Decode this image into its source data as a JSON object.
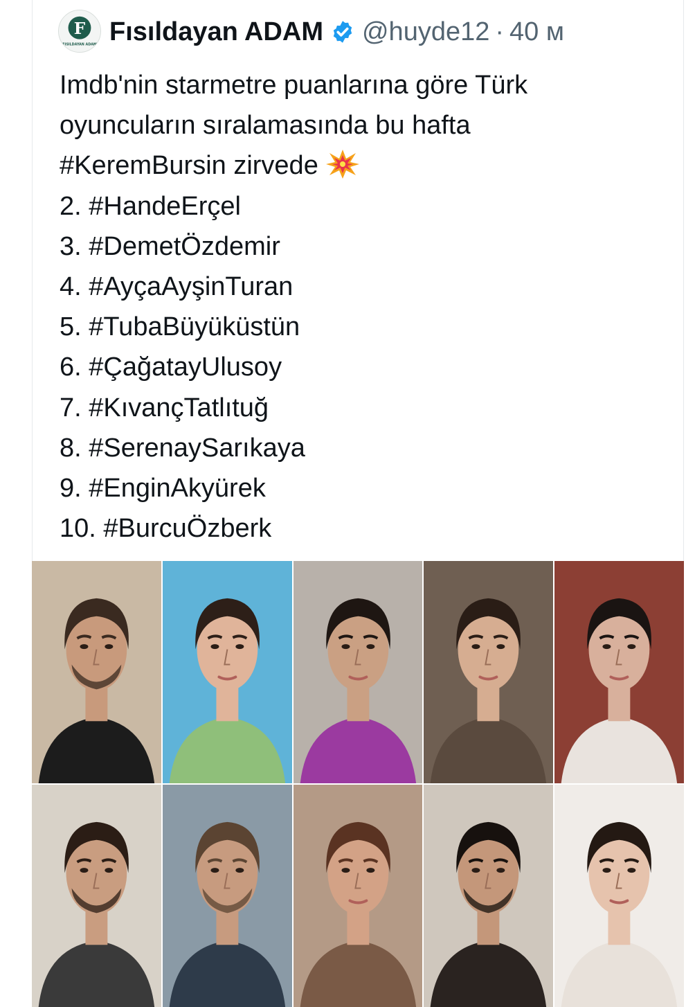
{
  "tweet": {
    "author_name": "Fısıldayan ADAM",
    "handle": "@huyde12",
    "separator": "·",
    "time": "40 м",
    "avatar_letter": "F",
    "avatar_caption": "FISILDAYAN ADAM",
    "text_lines": [
      "Imdb'nin starmetre puanlarına göre Türk",
      "oyuncuların sıralamasında bu hafta",
      "#KeremBursin zirvede",
      "2. #HandeErçel",
      "3. #DemetÖzdemir",
      "4. #AyçaAyşinTuran",
      "5. #TubaBüyüküstün",
      "6. #ÇağatayUlusoy",
      "7. #KıvançTatlıtuğ",
      "8. #SerenaySarıkaya",
      "9. #EnginAkyürek",
      "10. #BurcuÖzberk"
    ],
    "emoji": "collision-emoji"
  },
  "photos": [
    {
      "id": "photo-1",
      "bg": "#c9b9a4",
      "skin": "#c89a7c",
      "hair": "#3a2a20",
      "cloth": "#1c1c1c",
      "beard": true
    },
    {
      "id": "photo-2",
      "bg": "#5fb3d8",
      "skin": "#e0b49a",
      "hair": "#2d1f18",
      "cloth": "#8fbf7a",
      "beard": false
    },
    {
      "id": "photo-3",
      "bg": "#b8b1aa",
      "skin": "#caa083",
      "hair": "#1e1612",
      "cloth": "#9b3aa0",
      "beard": false
    },
    {
      "id": "photo-4",
      "bg": "#6f5f52",
      "skin": "#d6ad91",
      "hair": "#2a1d16",
      "cloth": "#5a4a3e",
      "beard": false
    },
    {
      "id": "photo-5",
      "bg": "#8c3f34",
      "skin": "#d8b09c",
      "hair": "#1a1412",
      "cloth": "#e9e3de",
      "beard": false
    },
    {
      "id": "photo-6",
      "bg": "#d8d2c8",
      "skin": "#c99d80",
      "hair": "#2b1d15",
      "cloth": "#3a3a3a",
      "beard": true
    },
    {
      "id": "photo-7",
      "bg": "#8a9aa6",
      "skin": "#c79b7f",
      "hair": "#5b4432",
      "cloth": "#2e3b4a",
      "beard": true
    },
    {
      "id": "photo-8",
      "bg": "#b49a86",
      "skin": "#d3a286",
      "hair": "#5a3322",
      "cloth": "#7a5a46",
      "beard": false
    },
    {
      "id": "photo-9",
      "bg": "#cfc7bd",
      "skin": "#c4977a",
      "hair": "#17110e",
      "cloth": "#2a2320",
      "beard": true
    },
    {
      "id": "photo-10",
      "bg": "#f0ece8",
      "skin": "#e6c3ad",
      "hair": "#241913",
      "cloth": "#e8e1da",
      "beard": false
    }
  ],
  "colors": {
    "verified": "#1d9bf0",
    "text": "#0f1419",
    "secondary": "#536471",
    "avatar_green": "#1f5c4c"
  }
}
